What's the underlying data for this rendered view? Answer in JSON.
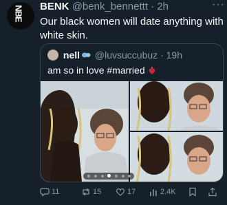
{
  "tweet": {
    "name": "BENK",
    "handle": "@benk_bennettt",
    "separator": "·",
    "time": "2h",
    "more": "···",
    "text": "Our black women will date anything with white skin."
  },
  "quote": {
    "name": "nell",
    "handle": "@luvsuccubuz",
    "separator": "·",
    "time": "19h",
    "text": "am so in love #married"
  },
  "actions": {
    "replies": "11",
    "retweets": "15",
    "likes": "17",
    "views": "2.4K"
  },
  "colors": {
    "background": "#15202b",
    "text": "#f7f9f9",
    "secondary": "#8b98a5",
    "border": "#38444d"
  }
}
